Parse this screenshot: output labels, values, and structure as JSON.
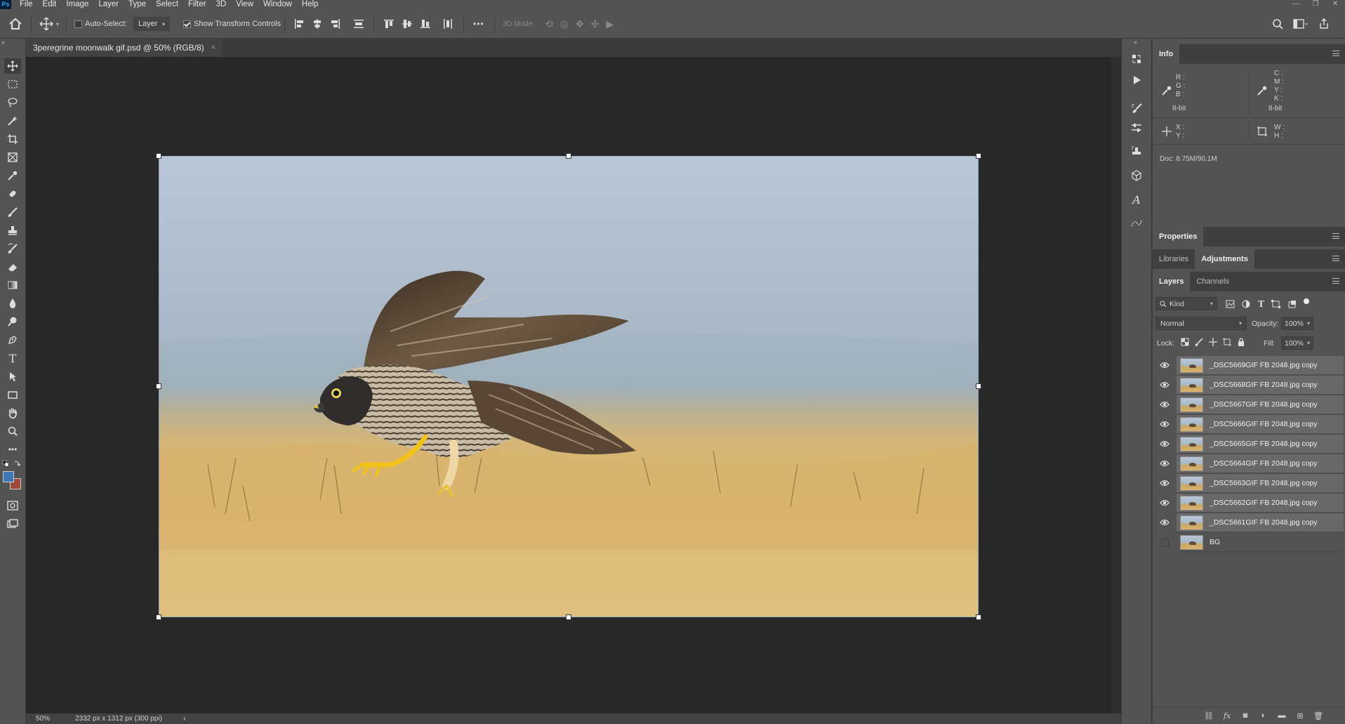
{
  "app": {
    "logo": "Ps"
  },
  "menu": [
    "File",
    "Edit",
    "Image",
    "Layer",
    "Type",
    "Select",
    "Filter",
    "3D",
    "View",
    "Window",
    "Help"
  ],
  "options": {
    "auto_select_label": "Auto-Select:",
    "auto_select_checked": false,
    "target_value": "Layer",
    "show_transform_label": "Show Transform Controls",
    "show_transform_checked": true,
    "three_d_mode_label": "3D Mode:",
    "more_label": "•••"
  },
  "document": {
    "tab_title": "3peregrine moonwalk gif.psd @ 50% (RGB/8)",
    "close_glyph": "×"
  },
  "status": {
    "zoom": "50%",
    "doc_info": "2332 px x 1312 px (300 ppi)",
    "arrow": "›"
  },
  "info_panel": {
    "tab": "Info",
    "rgb_labels": [
      "R :",
      "G :",
      "B :"
    ],
    "cmyk_labels": [
      "C :",
      "M :",
      "Y :",
      "K :"
    ],
    "bit_left": "8-bit",
    "bit_right": "8-bit",
    "xy_labels": [
      "X :",
      "Y :"
    ],
    "wh_labels": [
      "W :",
      "H :"
    ],
    "doc_size": "Doc: 8.75M/90.1M"
  },
  "properties_panel": {
    "tab": "Properties"
  },
  "libraries_panel": {
    "tabs": [
      "Libraries",
      "Adjustments"
    ],
    "active": "Adjustments"
  },
  "layers_panel": {
    "tabs": [
      "Layers",
      "Channels"
    ],
    "active": "Layers",
    "filter_value": "Kind",
    "blend_mode": "Normal",
    "opacity_label": "Opacity:",
    "opacity_value": "100%",
    "lock_label": "Lock:",
    "fill_label": "Fill:",
    "fill_value": "100%",
    "layers": [
      {
        "name": "_DSC5669GIF FB  2048.jpg copy",
        "visible": true,
        "selected": true
      },
      {
        "name": "_DSC5668GIF FB  2048.jpg copy",
        "visible": true,
        "selected": true
      },
      {
        "name": "_DSC5667GIF FB  2048.jpg copy",
        "visible": true,
        "selected": true
      },
      {
        "name": "_DSC5666GIF FB  2048.jpg copy",
        "visible": true,
        "selected": true
      },
      {
        "name": "_DSC5665GIF FB  2048.jpg copy",
        "visible": true,
        "selected": true
      },
      {
        "name": "_DSC5664GIF FB  2048.jpg copy",
        "visible": true,
        "selected": true
      },
      {
        "name": "_DSC5663GIF FB  2048.jpg copy",
        "visible": true,
        "selected": true
      },
      {
        "name": "_DSC5662GIF FB  2048.jpg copy",
        "visible": true,
        "selected": true
      },
      {
        "name": "_DSC5661GIF FB  2048.jpg copy",
        "visible": true,
        "selected": true
      },
      {
        "name": "BG",
        "visible": false,
        "selected": false
      }
    ]
  },
  "colors": {
    "accent_selection": "#686868",
    "foreground_swatch": "#3c78b4",
    "background_swatch": "#a0483c",
    "transform_handle": "#ffffff"
  },
  "icons": {
    "tools": [
      "move-icon",
      "marquee-icon",
      "lasso-icon",
      "quick-select-icon",
      "crop-icon",
      "frame-icon",
      "eyedropper-icon",
      "healing-brush-icon",
      "brush-icon",
      "clone-stamp-icon",
      "history-brush-icon",
      "eraser-icon",
      "gradient-icon",
      "blur-icon",
      "dodge-icon",
      "pen-icon",
      "type-icon",
      "path-select-icon",
      "rectangle-icon",
      "hand-icon",
      "zoom-icon",
      "more-tools-icon"
    ]
  }
}
